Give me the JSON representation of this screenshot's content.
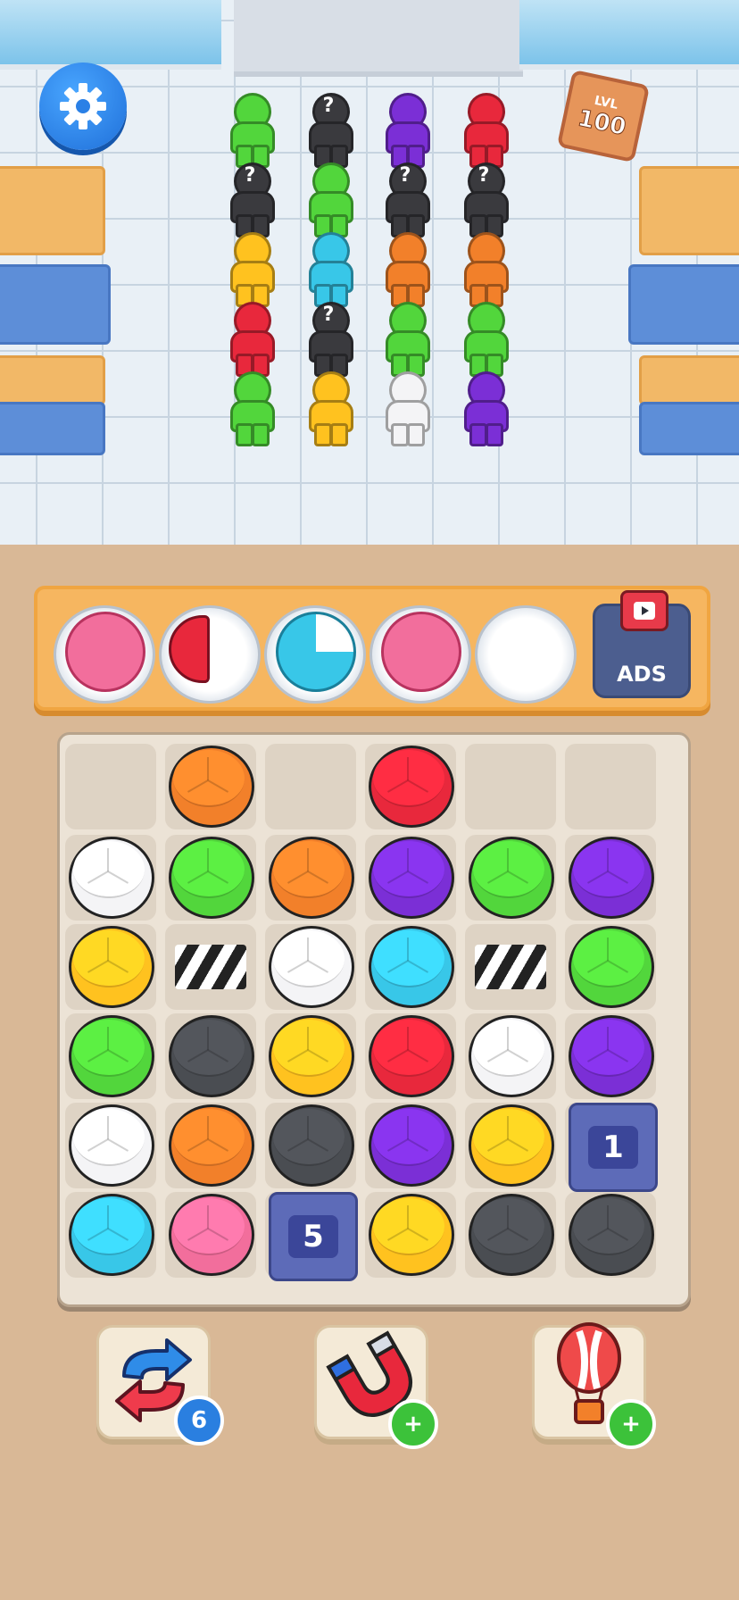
{
  "header": {
    "settings_icon": "gear-icon",
    "level_prefix": "LVL",
    "level_number": "100"
  },
  "queue": {
    "columns": [
      [
        "green",
        "mystery",
        "yellow",
        "red",
        "green"
      ],
      [
        "mystery",
        "green",
        "cyan",
        "mystery",
        "yellow"
      ],
      [
        "purple",
        "mystery",
        "orange",
        "green",
        "white"
      ],
      [
        "red",
        "mystery",
        "orange",
        "green",
        "purple"
      ]
    ],
    "mystery_mark": "?"
  },
  "tray": {
    "plates": [
      "pink-cake",
      "red-slice",
      "cyan-cake-partial",
      "pink-cake",
      "empty"
    ],
    "ads_label": "ADS"
  },
  "board": {
    "rows": [
      [
        "empty",
        "orange",
        "empty",
        "red",
        "empty",
        "empty"
      ],
      [
        "white",
        "green",
        "orange",
        "purple",
        "green",
        "purple"
      ],
      [
        "yellow",
        "blocked",
        "white",
        "cyan",
        "blocked",
        "green"
      ],
      [
        "green",
        "charcoal",
        "yellow",
        "red",
        "white",
        "purple"
      ],
      [
        "white",
        "orange",
        "charcoal",
        "purple",
        "yellow",
        "box"
      ],
      [
        "cyan",
        "pink",
        "box",
        "yellow",
        "charcoal",
        "charcoal"
      ]
    ],
    "box_counts": {
      "top": "1",
      "bottom": "5"
    }
  },
  "colors": {
    "green": "#52d63c",
    "yellow": "#ffc21f",
    "red": "#e8283c",
    "cyan": "#38c7e8",
    "purple": "#7b2fd6",
    "orange": "#f2802a",
    "white": "#f4f4f6",
    "mystery": "#3a3a3e",
    "pink": "#f26e9c",
    "charcoal": "#4a4d52"
  },
  "powerups": {
    "shuffle": {
      "icon": "shuffle-arrows-icon",
      "count": "6"
    },
    "magnet": {
      "icon": "magnet-icon",
      "badge": "+"
    },
    "balloon": {
      "icon": "hot-air-balloon-icon",
      "badge": "+"
    }
  }
}
